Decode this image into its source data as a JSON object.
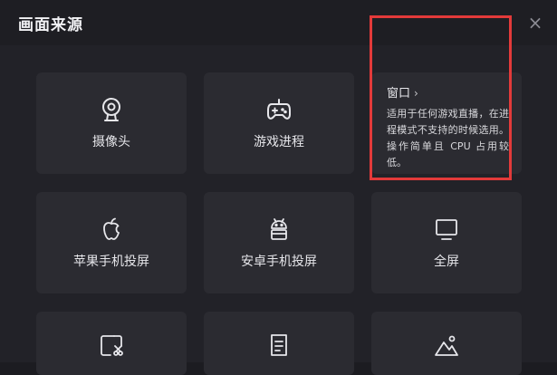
{
  "dialog": {
    "title": "画面来源",
    "close_glyph": "×"
  },
  "sources": [
    {
      "label": "摄像头",
      "icon": "webcam-icon"
    },
    {
      "label": "游戏进程",
      "icon": "gamepad-icon"
    },
    {
      "label": "窗口",
      "chevron": "›",
      "description": "适用于任何游戏直播，在进程模式不支持的时候选用。操作简单且 CPU 占用较低。"
    },
    {
      "label": "苹果手机投屏",
      "icon": "apple-icon"
    },
    {
      "label": "安卓手机投屏",
      "icon": "android-icon"
    },
    {
      "label": "全屏",
      "icon": "monitor-icon"
    },
    {
      "label": "",
      "icon": "region-capture-icon"
    },
    {
      "label": "",
      "icon": "document-icon"
    },
    {
      "label": "",
      "icon": "image-icon"
    }
  ],
  "colors": {
    "background": "#222228",
    "card": "#2b2b31",
    "highlight": "#e33a3a"
  }
}
